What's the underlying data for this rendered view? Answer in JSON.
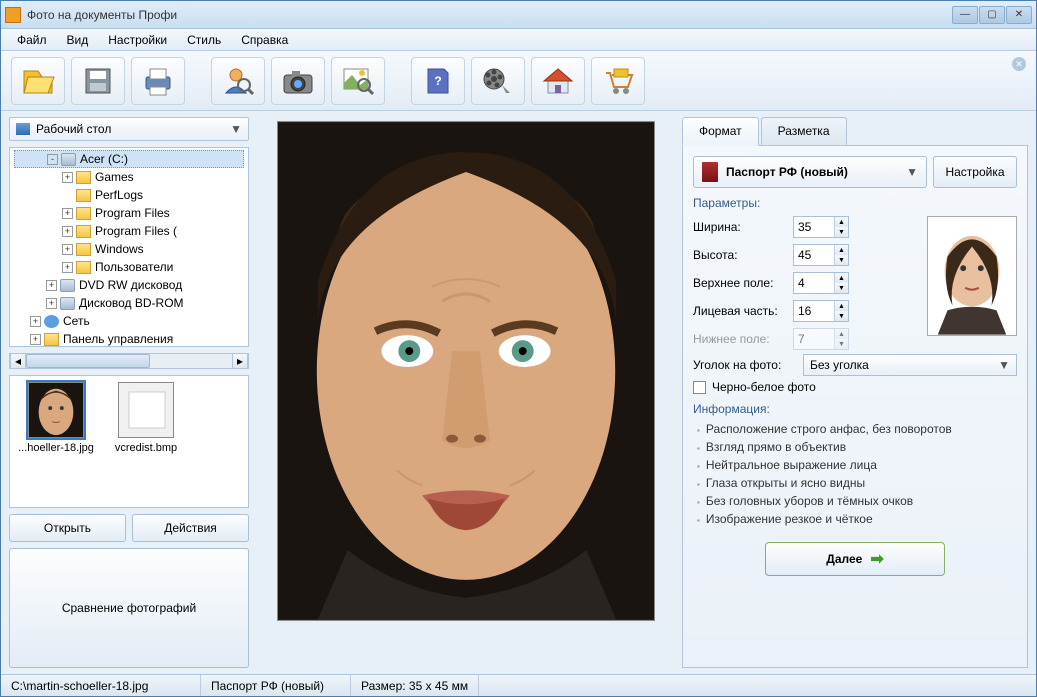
{
  "title": "Фото на документы Профи",
  "menu": [
    "Файл",
    "Вид",
    "Настройки",
    "Стиль",
    "Справка"
  ],
  "toolbar_icons": [
    "open-icon",
    "save-icon",
    "print-icon",
    "person-search-icon",
    "camera-icon",
    "photo-search-icon",
    "help-book-icon",
    "film-icon",
    "home-icon",
    "cart-icon"
  ],
  "root_location": "Рабочий стол",
  "tree": [
    {
      "indent": 2,
      "exp": "-",
      "icon": "disk",
      "label": "Acer (C:)",
      "selected": true
    },
    {
      "indent": 3,
      "exp": "+",
      "icon": "folder",
      "label": "Games"
    },
    {
      "indent": 3,
      "exp": "",
      "icon": "folder",
      "label": "PerfLogs"
    },
    {
      "indent": 3,
      "exp": "+",
      "icon": "folder",
      "label": "Program Files"
    },
    {
      "indent": 3,
      "exp": "+",
      "icon": "folder",
      "label": "Program Files ("
    },
    {
      "indent": 3,
      "exp": "+",
      "icon": "folder",
      "label": "Windows"
    },
    {
      "indent": 3,
      "exp": "+",
      "icon": "folder",
      "label": "Пользователи"
    },
    {
      "indent": 2,
      "exp": "+",
      "icon": "disk",
      "label": "DVD RW дисковод"
    },
    {
      "indent": 2,
      "exp": "+",
      "icon": "disk",
      "label": "Дисковод BD-ROM"
    },
    {
      "indent": 1,
      "exp": "+",
      "icon": "net",
      "label": "Сеть"
    },
    {
      "indent": 1,
      "exp": "+",
      "icon": "folder",
      "label": "Панель управления"
    }
  ],
  "thumbs": [
    {
      "label": "...hoeller-18.jpg",
      "selected": true
    },
    {
      "label": "vcredist.bmp",
      "selected": false
    }
  ],
  "left_buttons": {
    "open": "Открыть",
    "actions": "Действия",
    "compare": "Сравнение фотографий"
  },
  "tabs": {
    "format": "Формат",
    "markup": "Разметка"
  },
  "format_name": "Паспорт РФ (новый)",
  "settings_btn": "Настройка",
  "params_title": "Параметры:",
  "params": {
    "width": {
      "label": "Ширина:",
      "value": "35"
    },
    "height": {
      "label": "Высота:",
      "value": "45"
    },
    "top": {
      "label": "Верхнее поле:",
      "value": "4"
    },
    "face": {
      "label": "Лицевая часть:",
      "value": "16"
    },
    "bottom": {
      "label": "Нижнее поле:",
      "value": "7",
      "disabled": true
    }
  },
  "corner": {
    "label": "Уголок на фото:",
    "value": "Без уголка"
  },
  "bw_label": "Черно-белое фото",
  "info_title": "Информация:",
  "info_items": [
    "Расположение строго анфас, без поворотов",
    "Взгляд прямо в объектив",
    "Нейтральное выражение лица",
    "Глаза открыты и ясно видны",
    "Без головных уборов и тёмных очков",
    "Изображение резкое и чёткое"
  ],
  "next_btn": "Далее",
  "status": {
    "path": "C:\\martin-schoeller-18.jpg",
    "format": "Паспорт РФ (новый)",
    "size": "Размер: 35 x 45 мм"
  }
}
